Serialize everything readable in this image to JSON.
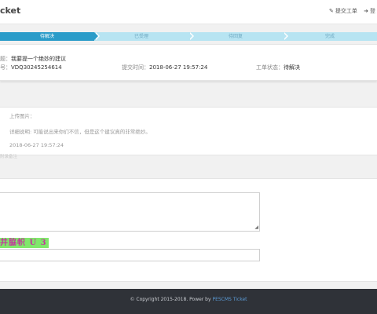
{
  "header": {
    "brand": "cket",
    "links": [
      {
        "icon": "submit-ticket-icon",
        "glyph": "✎",
        "label": "提交工单"
      },
      {
        "icon": "login-icon",
        "glyph": "➜",
        "label": "登"
      }
    ]
  },
  "progress": {
    "steps": [
      "待解决",
      "已受理",
      "待回复",
      "完成"
    ],
    "active_index": 0
  },
  "ticket": {
    "title_label": "题：",
    "title_value": "我要提一个绝妙的建议",
    "number_label": "号：",
    "number_value": "VDQ30245254614",
    "submit_time_label": "提交时间：",
    "submit_time_value": "2018-06-27 19:57:24",
    "status_label": "工单状态：",
    "status_value": "待解决"
  },
  "reply": {
    "upload_label": "上传图片：",
    "detail": "详细说明: 可能说出来你们不信，但是这个建议真的非常绝妙。",
    "time": "2018-06-27 19:57:24",
    "faint_text": "附录备注"
  },
  "form": {
    "captcha_text": "井脇帜 U 3"
  },
  "footer": {
    "copyright": "© Copyright 2015-2018. Power by ",
    "brand_link": "PESCMS Ticket"
  },
  "colors": {
    "active_step": "#2b9cc9",
    "inactive_step": "#b7e4f2",
    "footer_bg": "#2f3238",
    "captcha_bg": "#7fe86a"
  }
}
